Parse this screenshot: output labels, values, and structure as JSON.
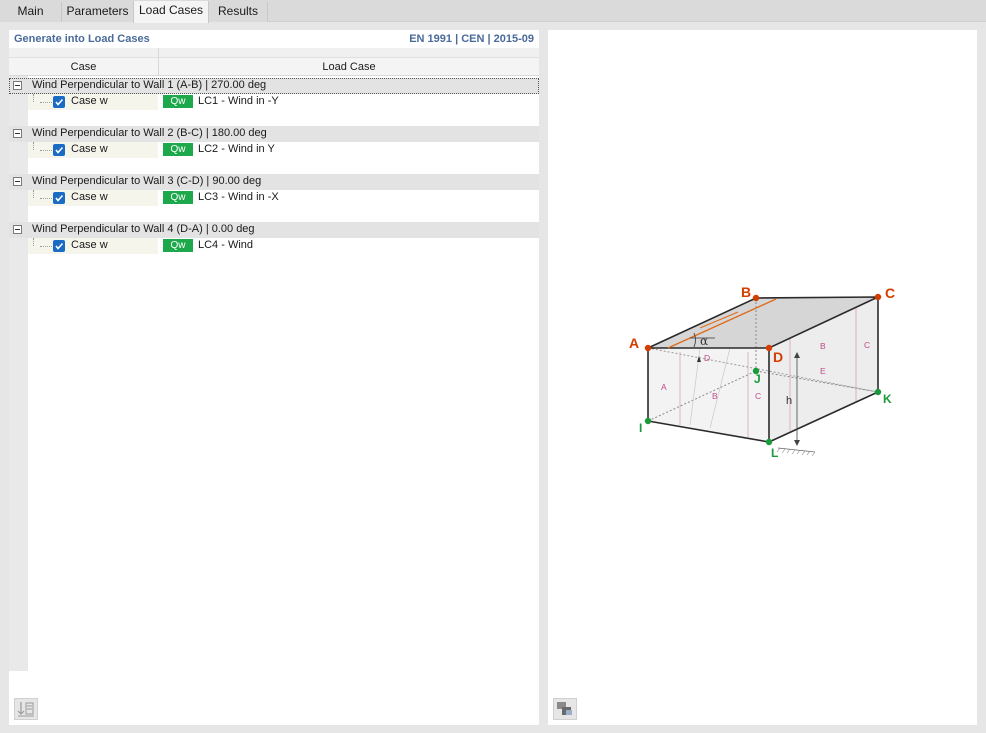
{
  "tabs": [
    "Main",
    "Parameters",
    "Load Cases",
    "Results"
  ],
  "panel": {
    "title": "Generate into Load Cases",
    "standard": "EN 1991 | CEN | 2015-09"
  },
  "columns": {
    "case": "Case",
    "load_case": "Load Case"
  },
  "groups": [
    {
      "label": "Wind Perpendicular to Wall 1 (A-B) | 270.00 deg",
      "case": "Case w",
      "badge": "Qw",
      "load_case": "LC1 - Wind in -Y"
    },
    {
      "label": "Wind Perpendicular to Wall 2 (B-C) | 180.00 deg",
      "case": "Case w",
      "badge": "Qw",
      "load_case": "LC2 - Wind in Y"
    },
    {
      "label": "Wind Perpendicular to Wall 3 (C-D) | 90.00 deg",
      "case": "Case w",
      "badge": "Qw",
      "load_case": "LC3 - Wind in -X"
    },
    {
      "label": "Wind Perpendicular to Wall 4 (D-A) | 0.00 deg",
      "case": "Case w",
      "badge": "Qw",
      "load_case": "LC4 - Wind"
    }
  ],
  "diagram": {
    "corner_labels": {
      "A": "A",
      "B": "B",
      "C": "C",
      "D": "D",
      "I": "I",
      "J": "J",
      "K": "K",
      "L": "L"
    },
    "zone_labels": [
      "A",
      "B",
      "C",
      "D",
      "E",
      "B",
      "C"
    ],
    "height_label": "h",
    "angle_label": "α",
    "colors": {
      "roof_corner": "#d43d00",
      "base_corner": "#1a9a3a",
      "zone": "#c04a8a",
      "ridge": "#e06a1a"
    }
  }
}
